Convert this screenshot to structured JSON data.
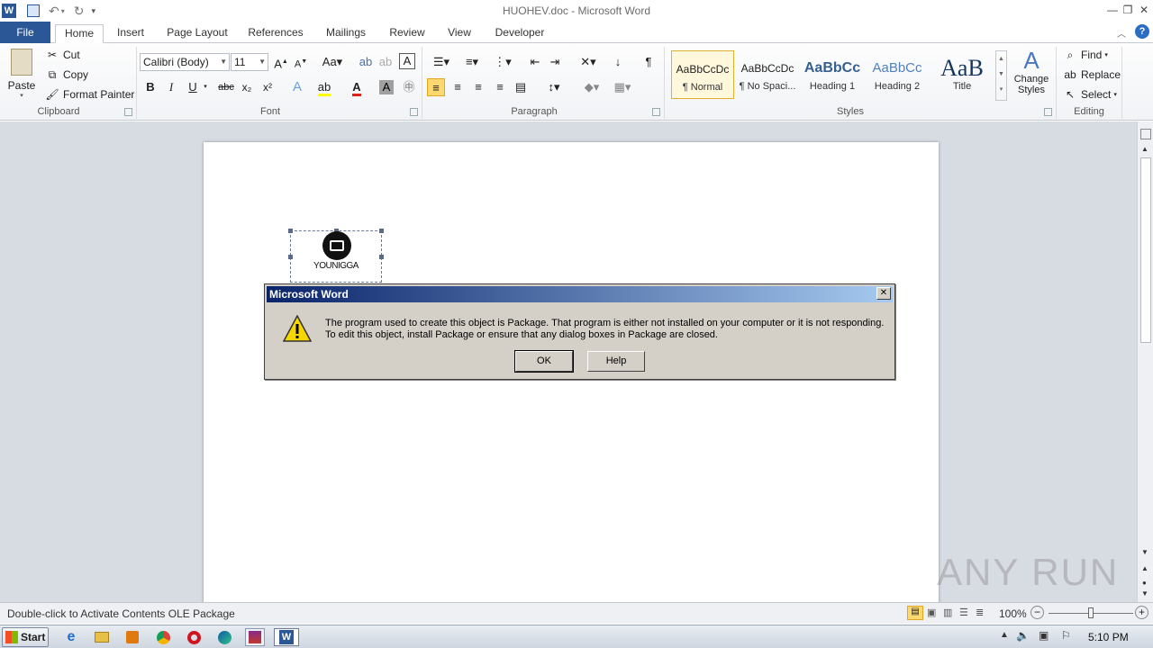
{
  "window": {
    "title": "HUOHEV.doc - Microsoft Word"
  },
  "tabs": [
    "File",
    "Home",
    "Insert",
    "Page Layout",
    "References",
    "Mailings",
    "Review",
    "View",
    "Developer"
  ],
  "clipboard": {
    "paste": "Paste",
    "cut": "Cut",
    "copy": "Copy",
    "format_painter": "Format Painter",
    "label": "Clipboard"
  },
  "font": {
    "name": "Calibri (Body)",
    "size": "11",
    "label": "Font",
    "bold": "B",
    "italic": "I",
    "underline": "U",
    "strike": "abc",
    "subscript": "x₂",
    "superscript": "x²"
  },
  "paragraph": {
    "label": "Paragraph"
  },
  "styles": {
    "label": "Styles",
    "items": [
      {
        "sample": "AaBbCcDc",
        "name": "¶ Normal"
      },
      {
        "sample": "AaBbCcDc",
        "name": "¶ No Spaci..."
      },
      {
        "sample": "AaBbCc",
        "name": "Heading 1"
      },
      {
        "sample": "AaBbCc",
        "name": "Heading 2"
      },
      {
        "sample": "AaB",
        "name": "Title"
      }
    ],
    "change_styles": "Change Styles"
  },
  "editing": {
    "find": "Find",
    "replace": "Replace",
    "select": "Select",
    "label": "Editing"
  },
  "ole_object": {
    "label": "YOUNIGGA"
  },
  "dialog": {
    "title": "Microsoft Word",
    "message_line1": "The program used to create this object is Package.  That program is either not installed on your computer or it is not responding.",
    "message_line2": "To edit this object, install Package or ensure that any dialog boxes in Package are closed.",
    "ok": "OK",
    "help": "Help"
  },
  "statusbar": {
    "text": "Double-click to Activate Contents OLE Package",
    "zoom": "100%"
  },
  "taskbar": {
    "start": "Start",
    "clock": "5:10 PM"
  },
  "watermark": "ANY RUN"
}
